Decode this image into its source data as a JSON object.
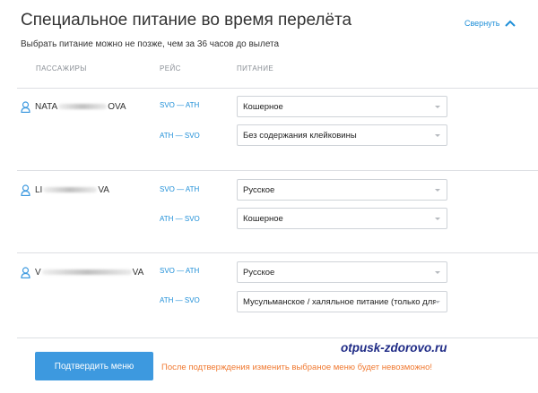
{
  "header": {
    "title": "Специальное питание во время перелёта",
    "collapse_label": "Свернуть",
    "subtitle": "Выбрать питание можно не позже, чем за 36 часов до вылета"
  },
  "columns": {
    "passengers": "ПАССАЖИРЫ",
    "flight": "РЕЙС",
    "meal": "ПИТАНИЕ"
  },
  "passengers": [
    {
      "name_start": "NATA",
      "name_end": "OVA",
      "flights": [
        {
          "route": "SVO — ATH",
          "meal": "Кошерное"
        },
        {
          "route": "ATH — SVO",
          "meal": "Без содержания клейковины"
        }
      ]
    },
    {
      "name_start": "LI",
      "name_end": "VA",
      "flights": [
        {
          "route": "SVO — ATH",
          "meal": "Русское"
        },
        {
          "route": "ATH — SVO",
          "meal": "Кошерное"
        }
      ]
    },
    {
      "name_start": "V",
      "name_end": "VA",
      "flights": [
        {
          "route": "SVO — ATH",
          "meal": "Русское"
        },
        {
          "route": "ATH — SVO",
          "meal": "Мусульманское / халяльное питание (только для"
        }
      ]
    }
  ],
  "footer": {
    "confirm_label": "Подтвердить меню",
    "warning": "После подтверждения изменить выбраное меню будет невозможно!"
  },
  "watermark": "otpusk-zdorovo.ru",
  "colors": {
    "accent": "#1f8fd8",
    "button": "#3d99df",
    "warning": "#f07a32",
    "watermark": "#1f2b86"
  }
}
